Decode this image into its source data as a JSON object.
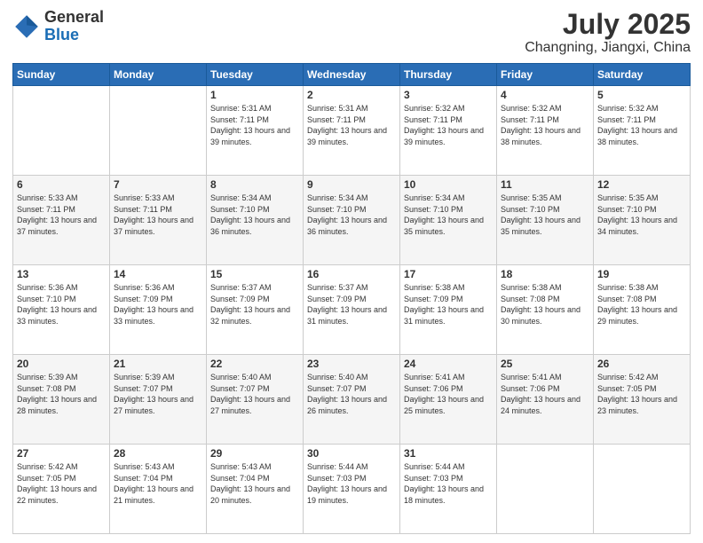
{
  "header": {
    "logo_general": "General",
    "logo_blue": "Blue",
    "month_title": "July 2025",
    "location": "Changning, Jiangxi, China"
  },
  "days_of_week": [
    "Sunday",
    "Monday",
    "Tuesday",
    "Wednesday",
    "Thursday",
    "Friday",
    "Saturday"
  ],
  "weeks": [
    [
      {
        "day": "",
        "info": ""
      },
      {
        "day": "",
        "info": ""
      },
      {
        "day": "1",
        "info": "Sunrise: 5:31 AM\nSunset: 7:11 PM\nDaylight: 13 hours and 39 minutes."
      },
      {
        "day": "2",
        "info": "Sunrise: 5:31 AM\nSunset: 7:11 PM\nDaylight: 13 hours and 39 minutes."
      },
      {
        "day": "3",
        "info": "Sunrise: 5:32 AM\nSunset: 7:11 PM\nDaylight: 13 hours and 39 minutes."
      },
      {
        "day": "4",
        "info": "Sunrise: 5:32 AM\nSunset: 7:11 PM\nDaylight: 13 hours and 38 minutes."
      },
      {
        "day": "5",
        "info": "Sunrise: 5:32 AM\nSunset: 7:11 PM\nDaylight: 13 hours and 38 minutes."
      }
    ],
    [
      {
        "day": "6",
        "info": "Sunrise: 5:33 AM\nSunset: 7:11 PM\nDaylight: 13 hours and 37 minutes."
      },
      {
        "day": "7",
        "info": "Sunrise: 5:33 AM\nSunset: 7:11 PM\nDaylight: 13 hours and 37 minutes."
      },
      {
        "day": "8",
        "info": "Sunrise: 5:34 AM\nSunset: 7:10 PM\nDaylight: 13 hours and 36 minutes."
      },
      {
        "day": "9",
        "info": "Sunrise: 5:34 AM\nSunset: 7:10 PM\nDaylight: 13 hours and 36 minutes."
      },
      {
        "day": "10",
        "info": "Sunrise: 5:34 AM\nSunset: 7:10 PM\nDaylight: 13 hours and 35 minutes."
      },
      {
        "day": "11",
        "info": "Sunrise: 5:35 AM\nSunset: 7:10 PM\nDaylight: 13 hours and 35 minutes."
      },
      {
        "day": "12",
        "info": "Sunrise: 5:35 AM\nSunset: 7:10 PM\nDaylight: 13 hours and 34 minutes."
      }
    ],
    [
      {
        "day": "13",
        "info": "Sunrise: 5:36 AM\nSunset: 7:10 PM\nDaylight: 13 hours and 33 minutes."
      },
      {
        "day": "14",
        "info": "Sunrise: 5:36 AM\nSunset: 7:09 PM\nDaylight: 13 hours and 33 minutes."
      },
      {
        "day": "15",
        "info": "Sunrise: 5:37 AM\nSunset: 7:09 PM\nDaylight: 13 hours and 32 minutes."
      },
      {
        "day": "16",
        "info": "Sunrise: 5:37 AM\nSunset: 7:09 PM\nDaylight: 13 hours and 31 minutes."
      },
      {
        "day": "17",
        "info": "Sunrise: 5:38 AM\nSunset: 7:09 PM\nDaylight: 13 hours and 31 minutes."
      },
      {
        "day": "18",
        "info": "Sunrise: 5:38 AM\nSunset: 7:08 PM\nDaylight: 13 hours and 30 minutes."
      },
      {
        "day": "19",
        "info": "Sunrise: 5:38 AM\nSunset: 7:08 PM\nDaylight: 13 hours and 29 minutes."
      }
    ],
    [
      {
        "day": "20",
        "info": "Sunrise: 5:39 AM\nSunset: 7:08 PM\nDaylight: 13 hours and 28 minutes."
      },
      {
        "day": "21",
        "info": "Sunrise: 5:39 AM\nSunset: 7:07 PM\nDaylight: 13 hours and 27 minutes."
      },
      {
        "day": "22",
        "info": "Sunrise: 5:40 AM\nSunset: 7:07 PM\nDaylight: 13 hours and 27 minutes."
      },
      {
        "day": "23",
        "info": "Sunrise: 5:40 AM\nSunset: 7:07 PM\nDaylight: 13 hours and 26 minutes."
      },
      {
        "day": "24",
        "info": "Sunrise: 5:41 AM\nSunset: 7:06 PM\nDaylight: 13 hours and 25 minutes."
      },
      {
        "day": "25",
        "info": "Sunrise: 5:41 AM\nSunset: 7:06 PM\nDaylight: 13 hours and 24 minutes."
      },
      {
        "day": "26",
        "info": "Sunrise: 5:42 AM\nSunset: 7:05 PM\nDaylight: 13 hours and 23 minutes."
      }
    ],
    [
      {
        "day": "27",
        "info": "Sunrise: 5:42 AM\nSunset: 7:05 PM\nDaylight: 13 hours and 22 minutes."
      },
      {
        "day": "28",
        "info": "Sunrise: 5:43 AM\nSunset: 7:04 PM\nDaylight: 13 hours and 21 minutes."
      },
      {
        "day": "29",
        "info": "Sunrise: 5:43 AM\nSunset: 7:04 PM\nDaylight: 13 hours and 20 minutes."
      },
      {
        "day": "30",
        "info": "Sunrise: 5:44 AM\nSunset: 7:03 PM\nDaylight: 13 hours and 19 minutes."
      },
      {
        "day": "31",
        "info": "Sunrise: 5:44 AM\nSunset: 7:03 PM\nDaylight: 13 hours and 18 minutes."
      },
      {
        "day": "",
        "info": ""
      },
      {
        "day": "",
        "info": ""
      }
    ]
  ]
}
